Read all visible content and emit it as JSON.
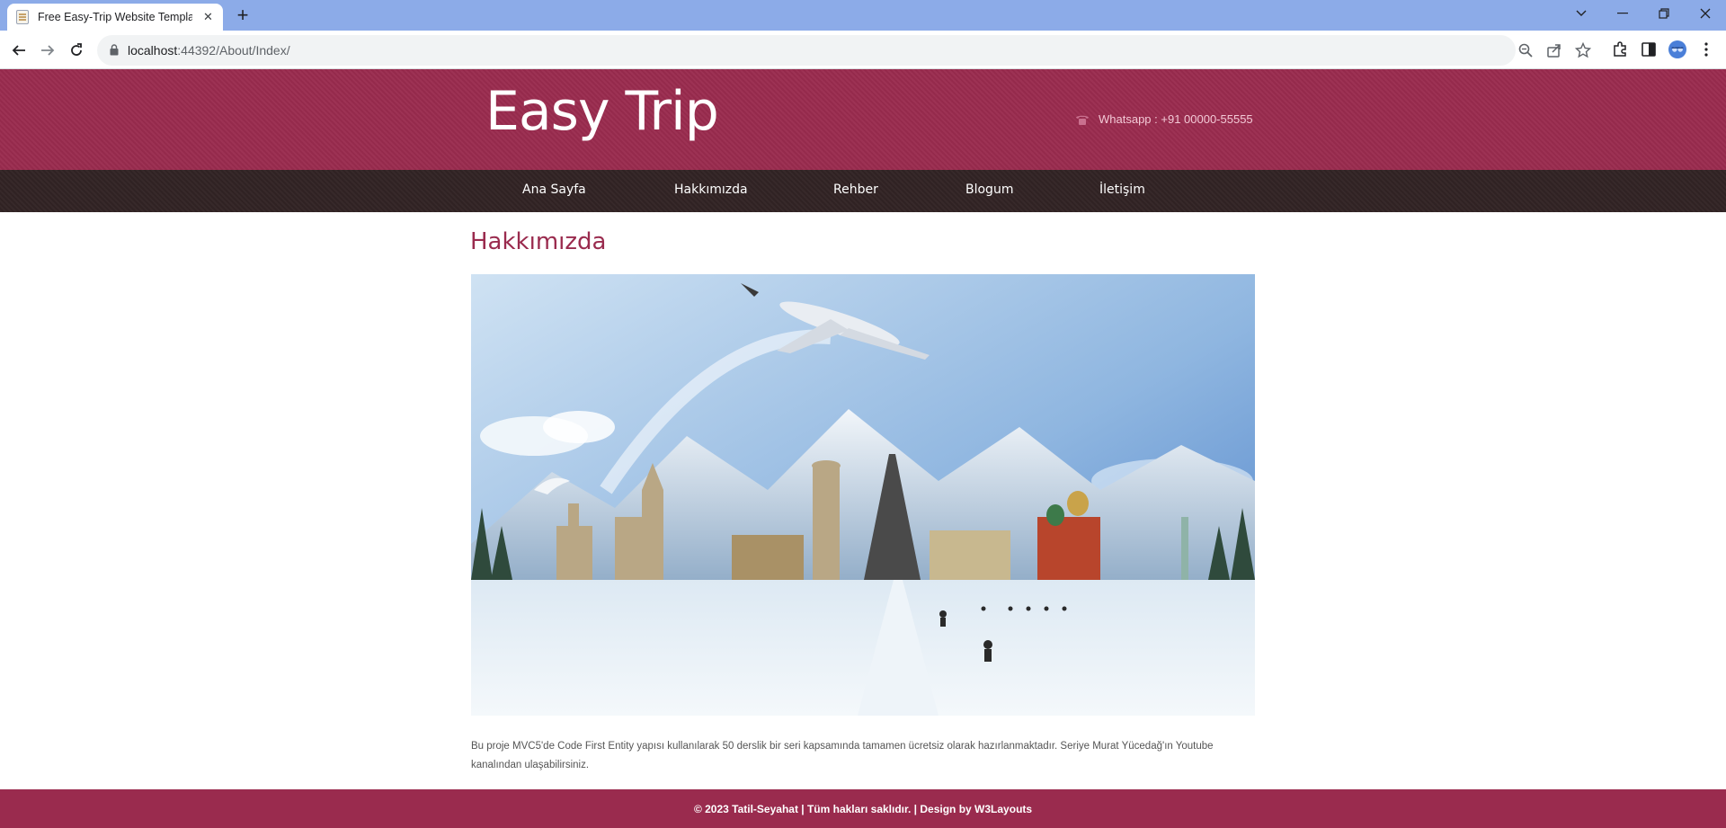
{
  "browser": {
    "tab_title": "Free Easy-Trip Website Template",
    "url_host": "localhost",
    "url_port_path": ":44392/About/Index/"
  },
  "site": {
    "logo": "Easy Trip",
    "contact": "Whatsapp : +91 00000-55555",
    "nav": [
      "Ana Sayfa",
      "Hakkımızda",
      "Rehber",
      "Blogum",
      "İletişim"
    ]
  },
  "main": {
    "title": "Hakkımızda",
    "text": "Bu proje MVC5'de Code First Entity yapısı kullanılarak 50 derslik bir seri kapsamında tamamen ücretsiz olarak hazırlanmaktadır. Seriye Murat Yücedağ'ın Youtube kanalından ulaşabilirsiniz."
  },
  "footer": {
    "text": "© 2023 Tatil-Seyahat | Tüm hakları saklıdır. | Design by W3Layouts"
  },
  "colors": {
    "brand": "#9a2b4e",
    "nav_bg": "#322425",
    "browser_frame": "#8cabe8"
  }
}
